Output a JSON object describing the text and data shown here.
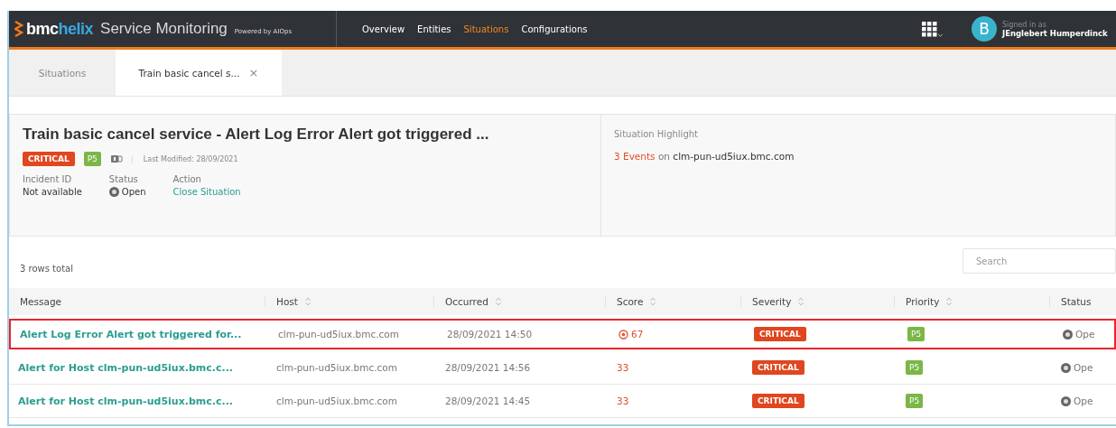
{
  "header": {
    "brand_prefix": "bmc",
    "brand_suffix": "helix",
    "product": "Service Monitoring",
    "tagline": "Powered by AIOps",
    "nav": [
      {
        "label": "Overview",
        "selected": false
      },
      {
        "label": "Entities",
        "selected": false
      },
      {
        "label": "Situations",
        "selected": true
      },
      {
        "label": "Configurations",
        "selected": false
      }
    ],
    "user": {
      "avatar_letter": "B",
      "signed_in_label": "Signed in as",
      "name": "JEnglebert Humperdinck"
    }
  },
  "tabs": [
    {
      "label": "Situations",
      "selected": false,
      "closable": false
    },
    {
      "label": "Train basic cancel s...",
      "selected": true,
      "closable": true
    }
  ],
  "tab_close": "×",
  "situation": {
    "title": "Train basic cancel service - Alert Log Error Alert got triggered ...",
    "severity": "CRITICAL",
    "priority": "P5",
    "last_modified": "Last Modified: 28/09/2021",
    "fields": [
      {
        "label": "Incident ID",
        "value": "Not available",
        "kind": "text"
      },
      {
        "label": "Status",
        "value": "Open",
        "kind": "status"
      },
      {
        "label": "Action",
        "value": "Close Situation",
        "kind": "link"
      }
    ],
    "highlight_title": "Situation Highlight",
    "highlight_count": "3 Events",
    "highlight_on": "on",
    "highlight_host": "clm-pun-ud5iux.bmc.com"
  },
  "rows_total": "3 rows total",
  "search": {
    "placeholder": "Search"
  },
  "table": {
    "columns": [
      {
        "label": "Message",
        "sortable": false
      },
      {
        "label": "Host",
        "sortable": true
      },
      {
        "label": "Occurred",
        "sortable": true
      },
      {
        "label": "Score",
        "sortable": true
      },
      {
        "label": "Severity",
        "sortable": true
      },
      {
        "label": "Priority",
        "sortable": true
      },
      {
        "label": "Status",
        "sortable": false
      }
    ],
    "rows": [
      {
        "message": "Alert Log Error Alert got triggered for...",
        "host": "clm-pun-ud5iux.bmc.com",
        "occurred": "28/09/2021 14:50",
        "score": "67",
        "score_flagged": true,
        "severity": "CRITICAL",
        "priority": "P5",
        "status": "Ope",
        "selected": true
      },
      {
        "message": "Alert for Host clm-pun-ud5iux.bmc.c...",
        "host": "clm-pun-ud5iux.bmc.com",
        "occurred": "28/09/2021 14:56",
        "score": "33",
        "score_flagged": false,
        "severity": "CRITICAL",
        "priority": "P5",
        "status": "Ope",
        "selected": false
      },
      {
        "message": "Alert for Host clm-pun-ud5iux.bmc.c...",
        "host": "clm-pun-ud5iux.bmc.com",
        "occurred": "28/09/2021 14:45",
        "score": "33",
        "score_flagged": false,
        "severity": "CRITICAL",
        "priority": "P5",
        "status": "Ope",
        "selected": false
      }
    ]
  }
}
